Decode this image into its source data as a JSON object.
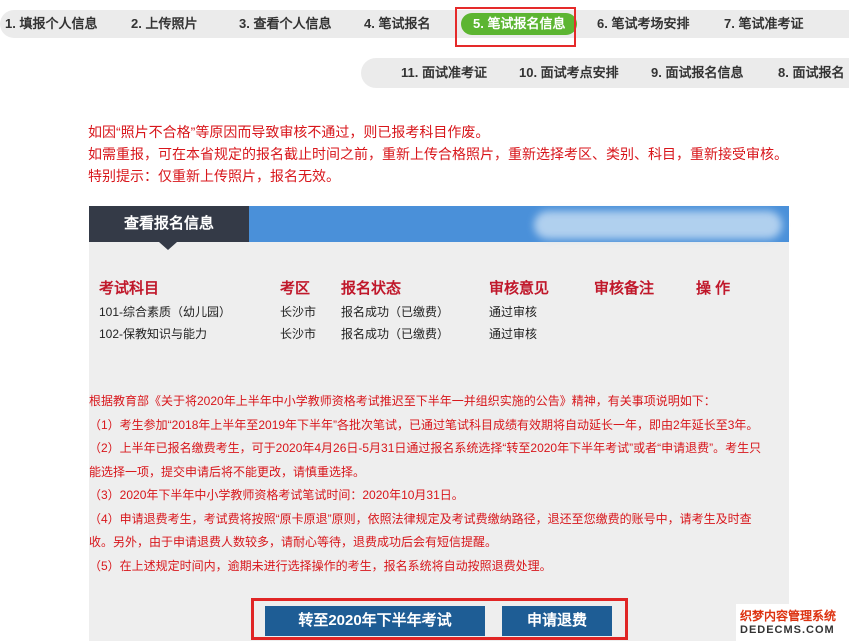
{
  "steps_top": [
    {
      "label": "1. 填报个人信息",
      "active": false
    },
    {
      "label": "2. 上传照片",
      "active": false
    },
    {
      "label": "3. 查看个人信息",
      "active": false
    },
    {
      "label": "4. 笔试报名",
      "active": false
    },
    {
      "label": "5. 笔试报名信息",
      "active": true
    },
    {
      "label": "6. 笔试考场安排",
      "active": false
    },
    {
      "label": "7. 笔试准考证",
      "active": false
    }
  ],
  "steps_bottom": [
    {
      "label": "11. 面试准考证"
    },
    {
      "label": "10. 面试考点安排"
    },
    {
      "label": "9. 面试报名信息"
    },
    {
      "label": "8. 面试报名"
    }
  ],
  "notice": [
    "如因“照片不合格”等原因而导致审核不通过，则已报考科目作废。",
    "如需重报，可在本省规定的报名截止时间之前，重新上传合格照片，重新选择考区、类别、科目，重新接受审核。",
    "特别提示：仅重新上传照片，报名无效。"
  ],
  "panel": {
    "title": "查看报名信息",
    "columns": [
      "考试科目",
      "考区",
      "报名状态",
      "审核意见",
      "审核备注",
      "操  作"
    ],
    "rows": [
      [
        "101-综合素质（幼儿园）",
        "长沙市",
        "报名成功（已缴费）",
        "通过审核",
        "",
        ""
      ],
      [
        "102-保教知识与能力",
        "长沙市",
        "报名成功（已缴费）",
        "通过审核",
        "",
        ""
      ]
    ],
    "rules": [
      "根据教育部《关于将2020年上半年中小学教师资格考试推迟至下半年一并组织实施的公告》精神，有关事项说明如下：",
      "（1）考生参加“2018年上半年至2019年下半年”各批次笔试，已通过笔试科目成绩有效期将自动延长一年，即由2年延长至3年。",
      "（2）上半年已报名缴费考生，可于2020年4月26日-5月31日通过报名系统选择“转至2020年下半年考试”或者“申请退费”。考生只",
      "能选择一项，提交申请后将不能更改，请慎重选择。",
      "（3）2020年下半年中小学教师资格考试笔试时间：2020年10月31日。",
      "（4）申请退费考生，考试费将按照“原卡原退”原则，依照法律规定及考试费缴纳路径，退还至您缴费的账号中，请考生及时查",
      "收。另外，由于申请退费人数较多，请耐心等待，退费成功后会有短信提醒。",
      "（5）在上述规定时间内，逾期未进行选择操作的考生，报名系统将自动按照退费处理。"
    ]
  },
  "buttons": {
    "transfer": "转至2020年下半年考试",
    "refund": "申请退费"
  },
  "watermark": {
    "line1": "织梦内容管理系统",
    "line2": "DEDECMS.COM"
  },
  "colors": {
    "active_step": "#5cb531",
    "notice_red": "#d8161b",
    "panel_head_blue": "#4a90d9",
    "panel_tab_dark": "#343a47",
    "button_blue": "#1e5d95",
    "highlight_frame": "#e52a2a"
  }
}
